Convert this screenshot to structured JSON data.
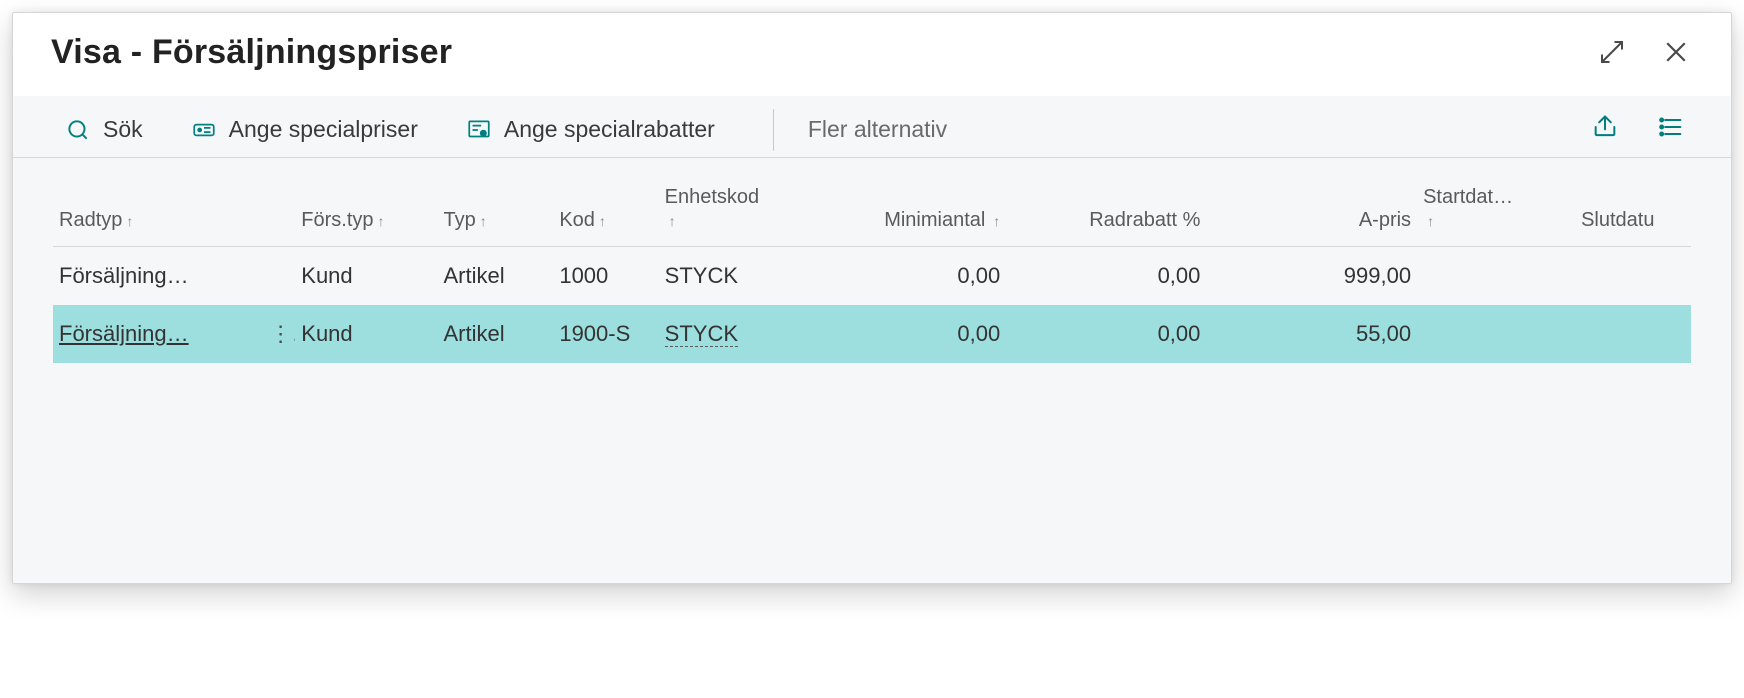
{
  "header": {
    "title": "Visa - Försäljningspriser"
  },
  "toolbar": {
    "search_label": "Sök",
    "special_prices_label": "Ange specialpriser",
    "special_discounts_label": "Ange specialrabatter",
    "more_options_label": "Fler alternativ"
  },
  "table": {
    "columns": {
      "radtyp": "Radtyp",
      "forstyp": "Förs.typ",
      "typ": "Typ",
      "kod": "Kod",
      "enhetskod": "Enhetskod",
      "minimiantal": "Minimiantal",
      "radrabatt": "Radrabatt %",
      "apris": "A-pris",
      "startdat": "Startdat…",
      "slutdatu": "Slutdatu"
    },
    "rows": [
      {
        "radtyp": "Försäljning…",
        "forstyp": "Kund",
        "typ": "Artikel",
        "kod": "1000",
        "enhetskod": "STYCK",
        "minimiantal": "0,00",
        "radrabatt": "0,00",
        "apris": "999,00",
        "startdat": "",
        "slutdat": ""
      },
      {
        "radtyp": "Försäljning…",
        "forstyp": "Kund",
        "typ": "Artikel",
        "kod": "1900-S",
        "enhetskod": "STYCK",
        "minimiantal": "0,00",
        "radrabatt": "0,00",
        "apris": "55,00",
        "startdat": "",
        "slutdat": ""
      }
    ]
  }
}
